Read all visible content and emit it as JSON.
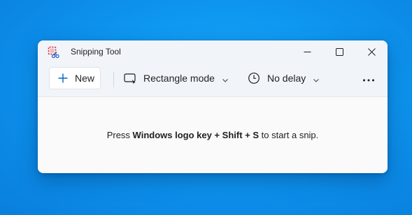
{
  "window": {
    "title": "Snipping Tool",
    "app_icon": "snipping-tool-icon",
    "controls": {
      "minimize_icon": "minimize-icon",
      "maximize_icon": "maximize-icon",
      "close_icon": "close-icon"
    }
  },
  "toolbar": {
    "new_label": "New",
    "new_icon": "plus-icon",
    "mode": {
      "icon": "rectangle-snip-icon",
      "label": "Rectangle mode",
      "chevron": "chevron-down-icon"
    },
    "delay": {
      "icon": "clock-icon",
      "label": "No delay",
      "chevron": "chevron-down-icon"
    },
    "more_icon": "more-options-icon"
  },
  "content": {
    "hint_prefix": "Press ",
    "hint_keys": "Windows logo key + Shift + S",
    "hint_suffix": " to start a snip."
  },
  "colors": {
    "desktop_blue": "#0f9af2",
    "accent": "#0067c0",
    "titlebar": "#f1f4f9",
    "window_bg": "#fafafa",
    "icon_red": "#d8303d"
  }
}
